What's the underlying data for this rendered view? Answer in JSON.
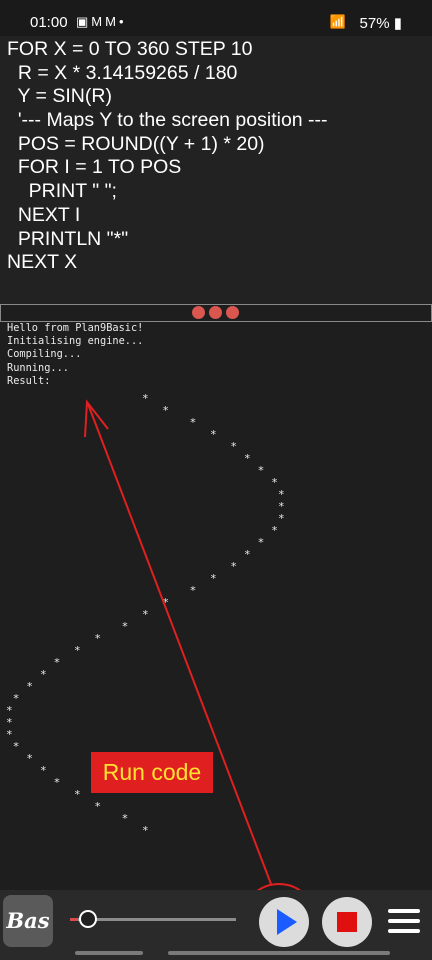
{
  "status_bar": {
    "time": "01:00",
    "left_icons": [
      "gallery-icon",
      "mail-icon",
      "mail-icon",
      "dot-icon"
    ],
    "right_icons": [
      "wifi-calling-icon",
      "signal-icon"
    ],
    "battery": "57%"
  },
  "editor": {
    "lines": [
      "FOR X = 0 TO 360 STEP 10",
      "  R = X * 3.14159265 / 180",
      "  Y = SIN(R)",
      "  '--- Maps Y to the screen position ---",
      "  POS = ROUND((Y + 1) * 20)",
      "  FOR I = 1 TO POS",
      "    PRINT \" \";",
      "  NEXT I",
      "  PRINTLN \"*\"",
      "NEXT X"
    ]
  },
  "console": {
    "lines": [
      "Hello from Plan9Basic!",
      "Initialising engine...",
      "Compiling...",
      "Running...",
      "Result:"
    ],
    "star_glyph": "*"
  },
  "annotation": {
    "label": "Run code",
    "color": "#e02020",
    "text_color": "#ffe033"
  },
  "toolbar": {
    "logo_text": "Bas",
    "progress": 0.05,
    "run_icon": "play-icon",
    "stop_icon": "stop-icon",
    "menu_icon": "hamburger-menu-icon"
  },
  "colors": {
    "splitter_grip": "#d9574f",
    "play": "#1a5cff",
    "stop": "#e01010"
  }
}
